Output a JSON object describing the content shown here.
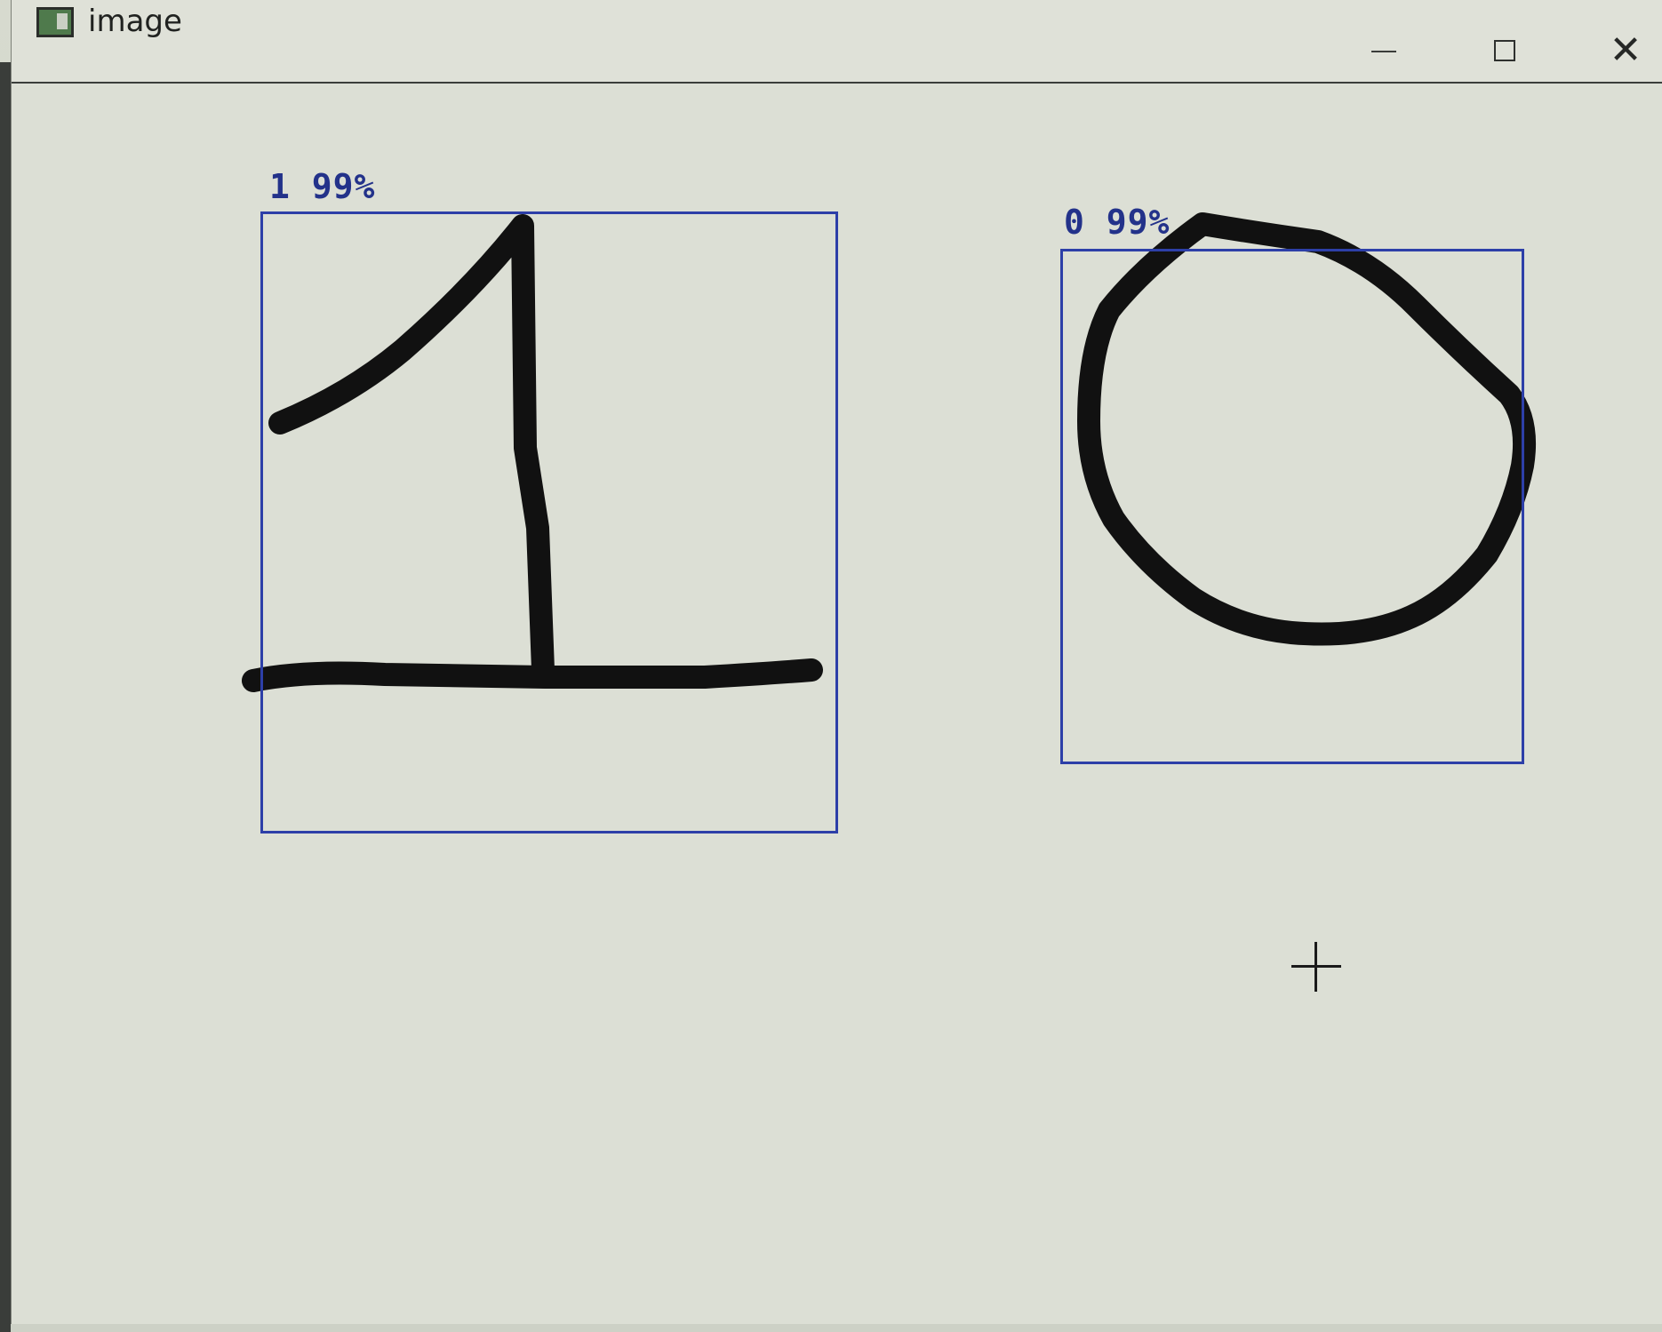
{
  "window": {
    "title": "image",
    "controls": {
      "minimize": "minimize",
      "maximize": "maximize",
      "close": "close"
    }
  },
  "detections": [
    {
      "label": "1",
      "confidence": "99%",
      "box_color": "#2d3fa8"
    },
    {
      "label": "0",
      "confidence": "99%",
      "box_color": "#2d3fa8"
    }
  ],
  "colors": {
    "label_text": "#23328a",
    "stroke": "#111111",
    "canvas_bg": "#dcdfd5"
  },
  "icons": {
    "app": "app-window-icon",
    "cursor": "crosshair-cursor-icon"
  }
}
